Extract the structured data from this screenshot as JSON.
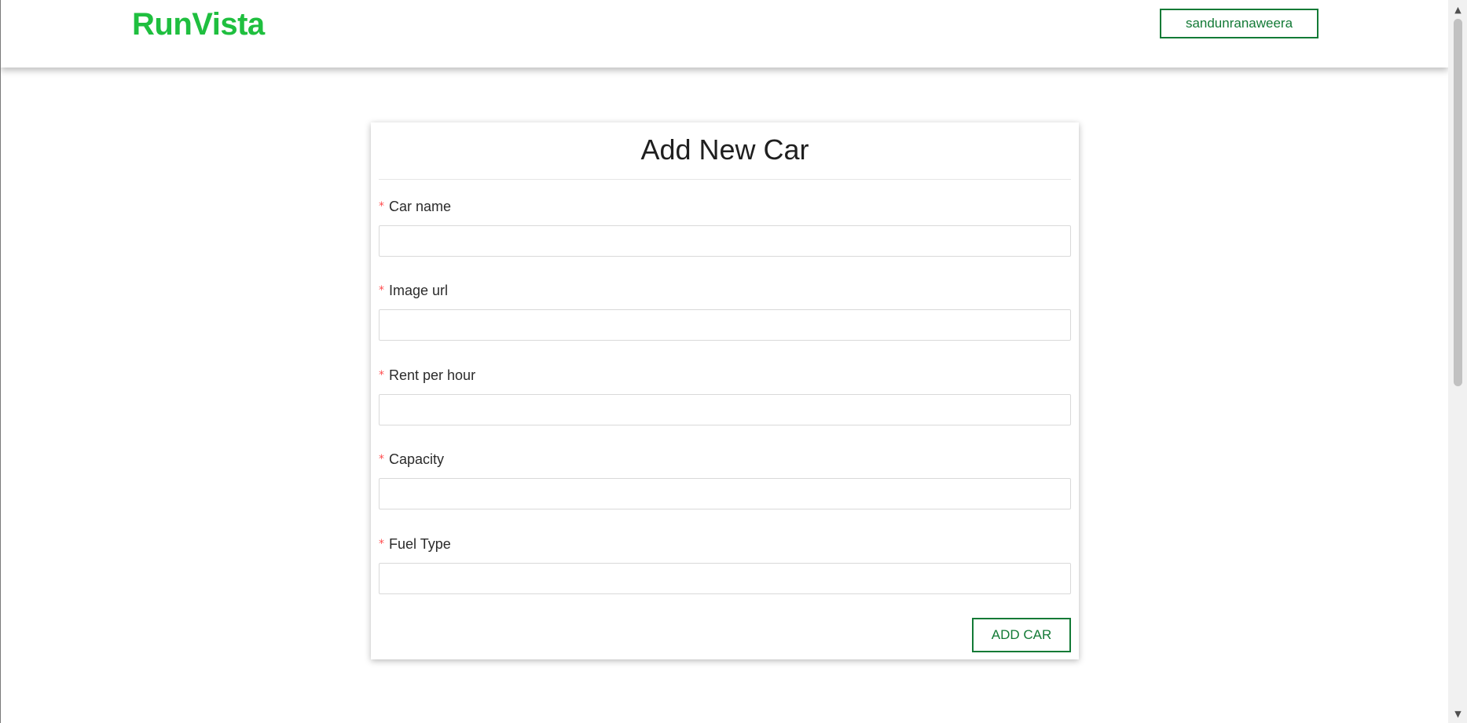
{
  "header": {
    "brand": "RunVista",
    "user_button_label": "sandunranaweera"
  },
  "form": {
    "title": "Add New Car",
    "required_mark": "*",
    "fields": [
      {
        "label": "Car name",
        "value": ""
      },
      {
        "label": "Image url",
        "value": ""
      },
      {
        "label": "Rent per hour",
        "value": ""
      },
      {
        "label": "Capacity",
        "value": ""
      },
      {
        "label": "Fuel Type",
        "value": ""
      }
    ],
    "submit_label": "ADD CAR"
  },
  "scrollbar": {
    "up_icon": "triangle-up-icon",
    "down_icon": "triangle-down-icon"
  },
  "colors": {
    "brand": "#1fbf3f",
    "accent": "#137a36",
    "required": "#ff4d4f"
  }
}
